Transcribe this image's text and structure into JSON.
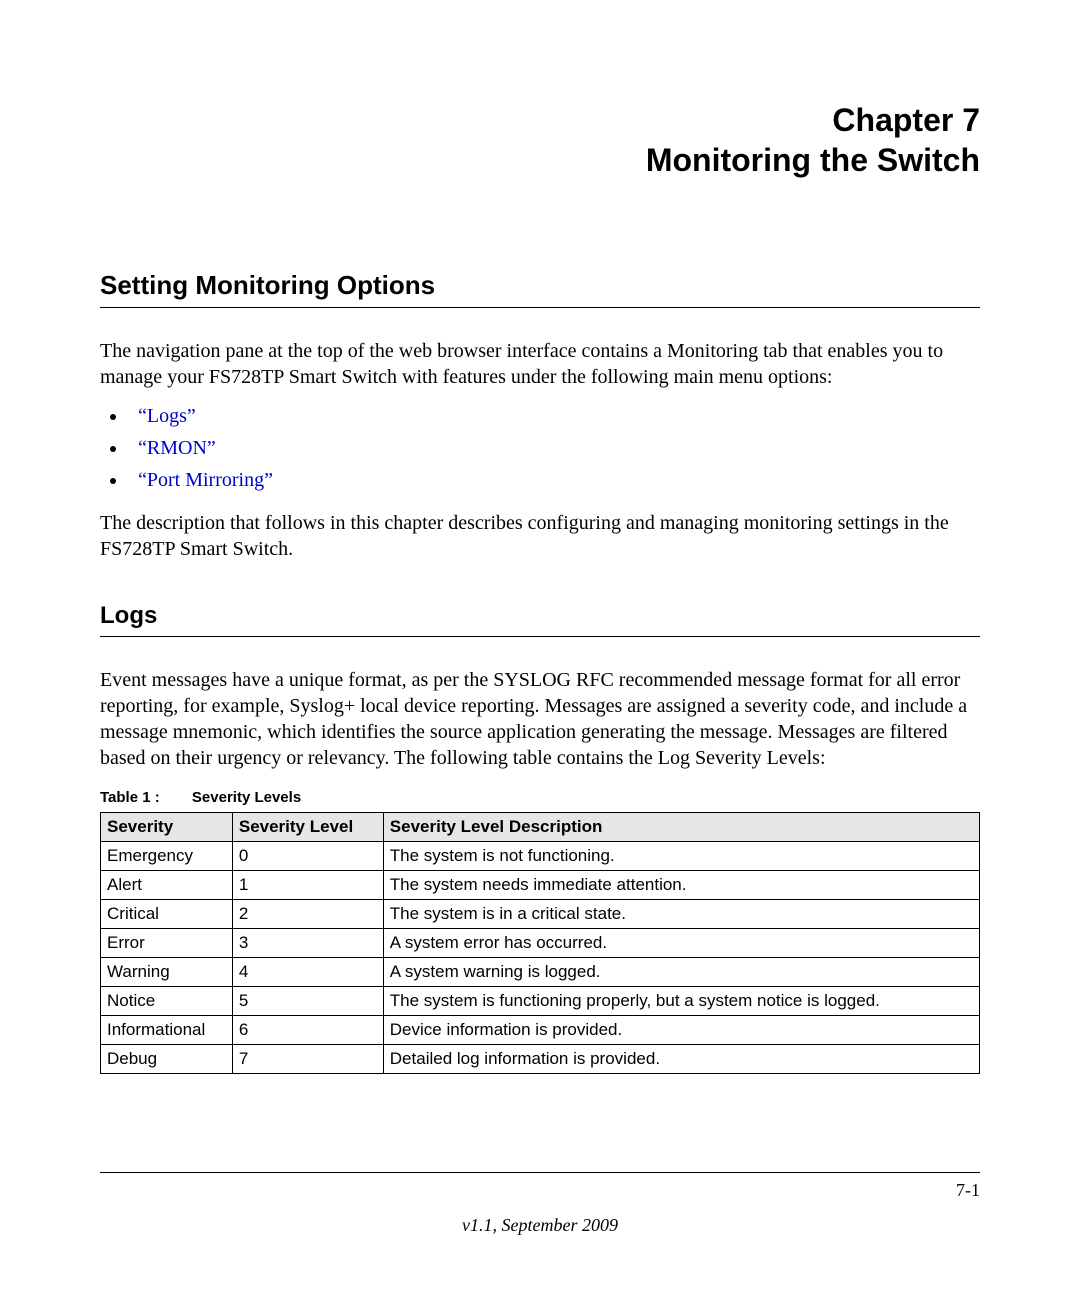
{
  "chapter": {
    "line1": "Chapter 7",
    "line2": "Monitoring the Switch"
  },
  "section1": {
    "heading": "Setting Monitoring Options",
    "para1": "The navigation pane at the top of the web browser interface contains a Monitoring tab that enables you to manage your FS728TP Smart Switch with features under the following main menu options:",
    "links": [
      "“Logs”",
      "“RMON”",
      "“Port Mirroring”"
    ],
    "para2": "The description that follows in this chapter describes configuring and managing monitoring settings in the FS728TP Smart Switch."
  },
  "section2": {
    "heading": "Logs",
    "para1": "Event messages have a unique format, as per the SYSLOG RFC recommended message format for all error reporting, for example, Syslog+ local device reporting. Messages are assigned a severity code, and include a message mnemonic, which identifies the source application generating the message. Messages are filtered based on their urgency or relevancy. The following table contains the Log Severity Levels:"
  },
  "table": {
    "caption_num": "Table 1 :",
    "caption_title": "Severity Levels",
    "headers": [
      "Severity",
      "Severity Level",
      "Severity Level Description"
    ],
    "rows": [
      [
        "Emergency",
        "0",
        "The system is not functioning."
      ],
      [
        "Alert",
        "1",
        "The system needs immediate attention."
      ],
      [
        "Critical",
        "2",
        "The system is in a critical state."
      ],
      [
        "Error",
        "3",
        "A system error has occurred."
      ],
      [
        "Warning",
        "4",
        "A system warning is logged."
      ],
      [
        "Notice",
        "5",
        "The system is functioning properly, but a system notice is logged."
      ],
      [
        "Informational",
        "6",
        "Device information is provided."
      ],
      [
        "Debug",
        "7",
        "Detailed log information is provided."
      ]
    ]
  },
  "footer": {
    "page_num": "7-1",
    "version": "v1.1, September 2009"
  }
}
